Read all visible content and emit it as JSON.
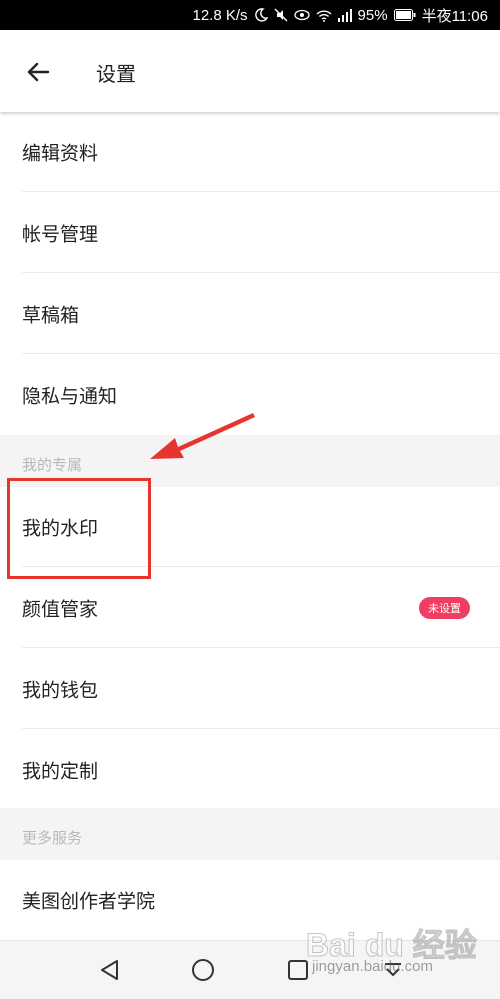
{
  "status_bar": {
    "network_speed": "12.8 K/s",
    "battery": "95%",
    "time": "半夜11:06",
    "icons": [
      "moon-icon",
      "mute-icon",
      "eye-icon",
      "wifi-icon",
      "signal-icon",
      "battery-icon"
    ]
  },
  "header": {
    "title": "设置",
    "back_icon": "arrow-left-icon"
  },
  "rows": {
    "edit_profile": "编辑资料",
    "account": "帐号管理",
    "drafts": "草稿箱",
    "privacy": "隐私与通知",
    "watermark": "我的水印",
    "beauty": "颜值管家",
    "beauty_badge": "未设置",
    "wallet": "我的钱包",
    "custom": "我的定制",
    "academy": "美图创作者学院"
  },
  "sections": {
    "exclusive": "我的专属",
    "more": "更多服务"
  },
  "nav_bar": {
    "icons": [
      "back-triangle-icon",
      "home-circle-icon",
      "recents-square-icon",
      "notification-down-icon"
    ]
  },
  "watermark": {
    "brand": "Bai du 经验",
    "url": "jingyan.baidu.com"
  },
  "colors": {
    "badge": "#ee3f62",
    "annotation": "#e8342f",
    "section_bg": "#f4f4f4"
  }
}
